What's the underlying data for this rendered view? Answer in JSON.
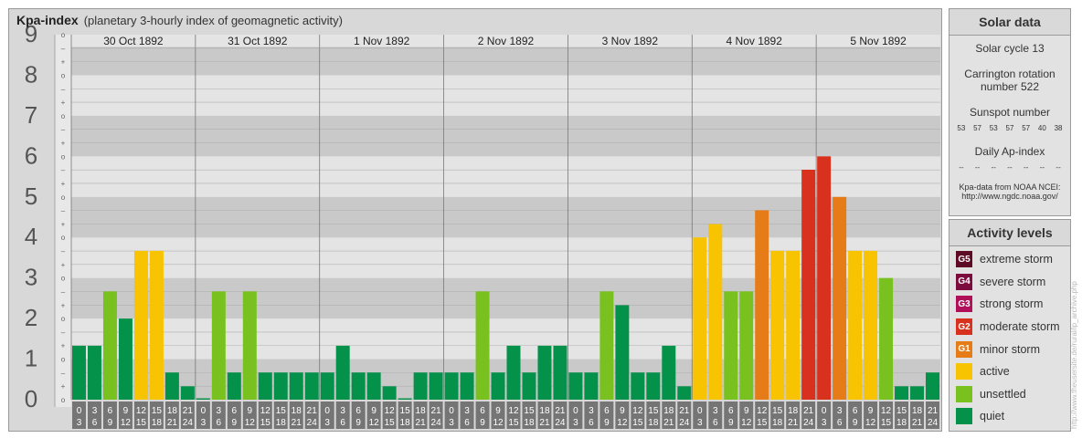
{
  "header": {
    "title": "Kpa-index",
    "subtitle": "(planetary 3-hourly index of geomagnetic activity)"
  },
  "chart_data": {
    "type": "bar",
    "ylim": [
      0,
      9
    ],
    "y_ticks": [
      "0",
      "1",
      "2",
      "3",
      "4",
      "5",
      "6",
      "7",
      "8",
      "9"
    ],
    "minor_tick_labels": [
      "o",
      "+",
      "–"
    ],
    "days": [
      "30 Oct 1892",
      "31 Oct 1892",
      "1 Nov 1892",
      "2 Nov 1892",
      "3 Nov 1892",
      "4 Nov 1892",
      "5 Nov 1892"
    ],
    "interval_labels": [
      [
        "0",
        "3"
      ],
      [
        "3",
        "6"
      ],
      [
        "6",
        "9"
      ],
      [
        "9",
        "12"
      ],
      [
        "12",
        "15"
      ],
      [
        "15",
        "18"
      ],
      [
        "18",
        "21"
      ],
      [
        "21",
        "24"
      ]
    ],
    "values": [
      1.33,
      1.33,
      2.67,
      2.0,
      3.67,
      3.67,
      0.67,
      0.33,
      0.0,
      2.67,
      0.67,
      2.67,
      0.67,
      0.67,
      0.67,
      0.67,
      0.67,
      1.33,
      0.67,
      0.67,
      0.33,
      0.0,
      0.67,
      0.67,
      0.67,
      0.67,
      2.67,
      0.67,
      1.33,
      0.67,
      1.33,
      1.33,
      0.67,
      0.67,
      2.67,
      2.33,
      0.67,
      0.67,
      1.33,
      0.33,
      4.0,
      4.33,
      2.67,
      2.67,
      4.67,
      3.67,
      3.67,
      5.67,
      6.0,
      5.0,
      3.67,
      3.67,
      3.0,
      0.33,
      0.33,
      0.67
    ]
  },
  "solar": {
    "heading": "Solar data",
    "cycle": "Solar cycle 13",
    "carrington_1": "Carrington rotation",
    "carrington_2": "number 522",
    "sunspot_label": "Sunspot number",
    "sunspots": [
      "53",
      "57",
      "53",
      "57",
      "57",
      "40",
      "38"
    ],
    "ap_label": "Daily Ap-index",
    "ap_values": [
      "--",
      "--",
      "--",
      "--",
      "--",
      "--",
      "--"
    ],
    "source_1": "Kpa-data from NOAA NCEI:",
    "source_2": "http://www.ngdc.noaa.gov/"
  },
  "activity": {
    "heading": "Activity levels",
    "levels": [
      {
        "badge": "G5",
        "label": "extreme storm",
        "color": "#5e0c26"
      },
      {
        "badge": "G4",
        "label": "severe storm",
        "color": "#7d0c3e"
      },
      {
        "badge": "G3",
        "label": "strong storm",
        "color": "#b0105a"
      },
      {
        "badge": "G2",
        "label": "moderate storm",
        "color": "#d8321e"
      },
      {
        "badge": "G1",
        "label": "minor storm",
        "color": "#e67c17"
      },
      {
        "badge": "",
        "label": "active",
        "color": "#f8c300"
      },
      {
        "badge": "",
        "label": "unsettled",
        "color": "#78c11e"
      },
      {
        "badge": "",
        "label": "quiet",
        "color": "#04914a"
      }
    ]
  },
  "watermark": "http://www.theusersite.de/rural/ip_archive.php"
}
